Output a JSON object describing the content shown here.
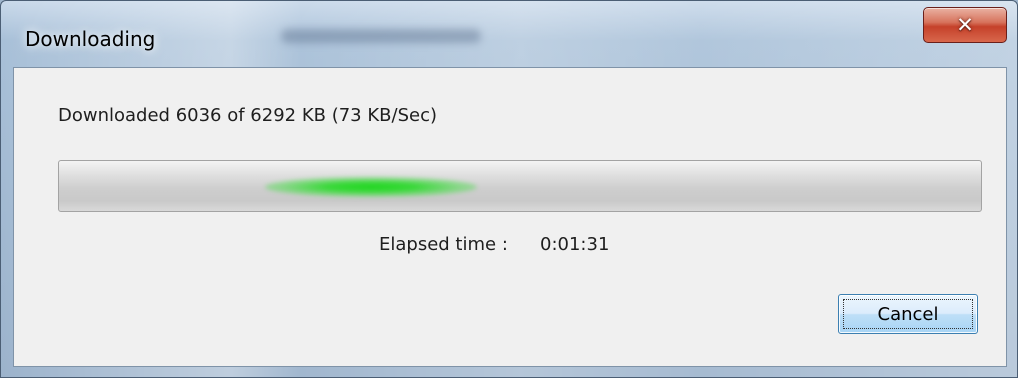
{
  "window": {
    "title": "Downloading",
    "close_icon": "close-icon"
  },
  "status": {
    "text": "Downloaded 6036 of 6292 KB (73 KB/Sec)"
  },
  "progress": {
    "style": "marquee",
    "color": "#22d422"
  },
  "elapsed": {
    "label": "Elapsed time :",
    "value": "0:01:31"
  },
  "buttons": {
    "cancel_label": "Cancel"
  },
  "colors": {
    "close_button": "#c5412a",
    "cancel_border": "#3c7fb1"
  }
}
